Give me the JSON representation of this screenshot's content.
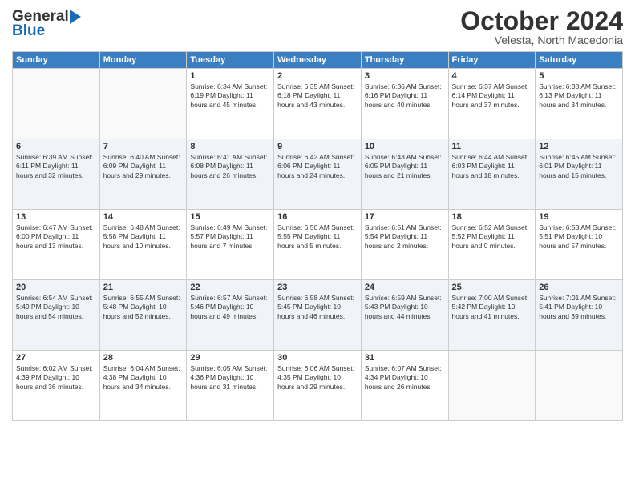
{
  "header": {
    "logo_general": "General",
    "logo_blue": "Blue",
    "month": "October 2024",
    "location": "Velesta, North Macedonia"
  },
  "weekdays": [
    "Sunday",
    "Monday",
    "Tuesday",
    "Wednesday",
    "Thursday",
    "Friday",
    "Saturday"
  ],
  "rows": [
    [
      {
        "day": "",
        "detail": ""
      },
      {
        "day": "",
        "detail": ""
      },
      {
        "day": "1",
        "detail": "Sunrise: 6:34 AM\nSunset: 6:19 PM\nDaylight: 11 hours\nand 45 minutes."
      },
      {
        "day": "2",
        "detail": "Sunrise: 6:35 AM\nSunset: 6:18 PM\nDaylight: 11 hours\nand 43 minutes."
      },
      {
        "day": "3",
        "detail": "Sunrise: 6:36 AM\nSunset: 6:16 PM\nDaylight: 11 hours\nand 40 minutes."
      },
      {
        "day": "4",
        "detail": "Sunrise: 6:37 AM\nSunset: 6:14 PM\nDaylight: 11 hours\nand 37 minutes."
      },
      {
        "day": "5",
        "detail": "Sunrise: 6:38 AM\nSunset: 6:13 PM\nDaylight: 11 hours\nand 34 minutes."
      }
    ],
    [
      {
        "day": "6",
        "detail": "Sunrise: 6:39 AM\nSunset: 6:11 PM\nDaylight: 11 hours\nand 32 minutes."
      },
      {
        "day": "7",
        "detail": "Sunrise: 6:40 AM\nSunset: 6:09 PM\nDaylight: 11 hours\nand 29 minutes."
      },
      {
        "day": "8",
        "detail": "Sunrise: 6:41 AM\nSunset: 6:08 PM\nDaylight: 11 hours\nand 26 minutes."
      },
      {
        "day": "9",
        "detail": "Sunrise: 6:42 AM\nSunset: 6:06 PM\nDaylight: 11 hours\nand 24 minutes."
      },
      {
        "day": "10",
        "detail": "Sunrise: 6:43 AM\nSunset: 6:05 PM\nDaylight: 11 hours\nand 21 minutes."
      },
      {
        "day": "11",
        "detail": "Sunrise: 6:44 AM\nSunset: 6:03 PM\nDaylight: 11 hours\nand 18 minutes."
      },
      {
        "day": "12",
        "detail": "Sunrise: 6:45 AM\nSunset: 6:01 PM\nDaylight: 11 hours\nand 15 minutes."
      }
    ],
    [
      {
        "day": "13",
        "detail": "Sunrise: 6:47 AM\nSunset: 6:00 PM\nDaylight: 11 hours\nand 13 minutes."
      },
      {
        "day": "14",
        "detail": "Sunrise: 6:48 AM\nSunset: 5:58 PM\nDaylight: 11 hours\nand 10 minutes."
      },
      {
        "day": "15",
        "detail": "Sunrise: 6:49 AM\nSunset: 5:57 PM\nDaylight: 11 hours\nand 7 minutes."
      },
      {
        "day": "16",
        "detail": "Sunrise: 6:50 AM\nSunset: 5:55 PM\nDaylight: 11 hours\nand 5 minutes."
      },
      {
        "day": "17",
        "detail": "Sunrise: 6:51 AM\nSunset: 5:54 PM\nDaylight: 11 hours\nand 2 minutes."
      },
      {
        "day": "18",
        "detail": "Sunrise: 6:52 AM\nSunset: 5:52 PM\nDaylight: 11 hours\nand 0 minutes."
      },
      {
        "day": "19",
        "detail": "Sunrise: 6:53 AM\nSunset: 5:51 PM\nDaylight: 10 hours\nand 57 minutes."
      }
    ],
    [
      {
        "day": "20",
        "detail": "Sunrise: 6:54 AM\nSunset: 5:49 PM\nDaylight: 10 hours\nand 54 minutes."
      },
      {
        "day": "21",
        "detail": "Sunrise: 6:55 AM\nSunset: 5:48 PM\nDaylight: 10 hours\nand 52 minutes."
      },
      {
        "day": "22",
        "detail": "Sunrise: 6:57 AM\nSunset: 5:46 PM\nDaylight: 10 hours\nand 49 minutes."
      },
      {
        "day": "23",
        "detail": "Sunrise: 6:58 AM\nSunset: 5:45 PM\nDaylight: 10 hours\nand 46 minutes."
      },
      {
        "day": "24",
        "detail": "Sunrise: 6:59 AM\nSunset: 5:43 PM\nDaylight: 10 hours\nand 44 minutes."
      },
      {
        "day": "25",
        "detail": "Sunrise: 7:00 AM\nSunset: 5:42 PM\nDaylight: 10 hours\nand 41 minutes."
      },
      {
        "day": "26",
        "detail": "Sunrise: 7:01 AM\nSunset: 5:41 PM\nDaylight: 10 hours\nand 39 minutes."
      }
    ],
    [
      {
        "day": "27",
        "detail": "Sunrise: 6:02 AM\nSunset: 4:39 PM\nDaylight: 10 hours\nand 36 minutes."
      },
      {
        "day": "28",
        "detail": "Sunrise: 6:04 AM\nSunset: 4:38 PM\nDaylight: 10 hours\nand 34 minutes."
      },
      {
        "day": "29",
        "detail": "Sunrise: 6:05 AM\nSunset: 4:36 PM\nDaylight: 10 hours\nand 31 minutes."
      },
      {
        "day": "30",
        "detail": "Sunrise: 6:06 AM\nSunset: 4:35 PM\nDaylight: 10 hours\nand 29 minutes."
      },
      {
        "day": "31",
        "detail": "Sunrise: 6:07 AM\nSunset: 4:34 PM\nDaylight: 10 hours\nand 26 minutes."
      },
      {
        "day": "",
        "detail": ""
      },
      {
        "day": "",
        "detail": ""
      }
    ]
  ]
}
